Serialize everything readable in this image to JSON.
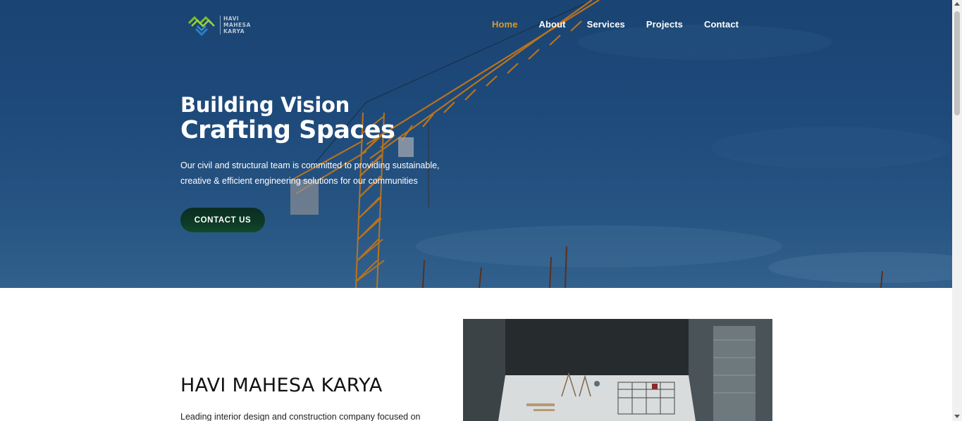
{
  "brand": {
    "name_lines": [
      "HAVI",
      "MAHESA",
      "KARYA"
    ],
    "colors": {
      "logo_green": "#7bbf2a",
      "logo_blue": "#2a7fc4",
      "accent_orange": "#d99c2a"
    }
  },
  "nav": {
    "items": [
      {
        "label": "Home",
        "active": true
      },
      {
        "label": "About",
        "active": false
      },
      {
        "label": "Services",
        "active": false
      },
      {
        "label": "Projects",
        "active": false
      },
      {
        "label": "Contact",
        "active": false
      }
    ]
  },
  "hero": {
    "title_line1": "Building Vision",
    "title_line2": "Crafting Spaces",
    "description": "Our civil and structural team is committed to providing sustainable, creative & efficient engineering solutions for our communities",
    "cta_label": "CONTACT US",
    "background_colors": {
      "sky_top": "#1a4472",
      "sky_bottom": "#2b5a86",
      "crane": "#b8731f"
    }
  },
  "about": {
    "title": "HAVI MAHESA KARYA",
    "description": "Leading interior design and construction company focused on"
  }
}
